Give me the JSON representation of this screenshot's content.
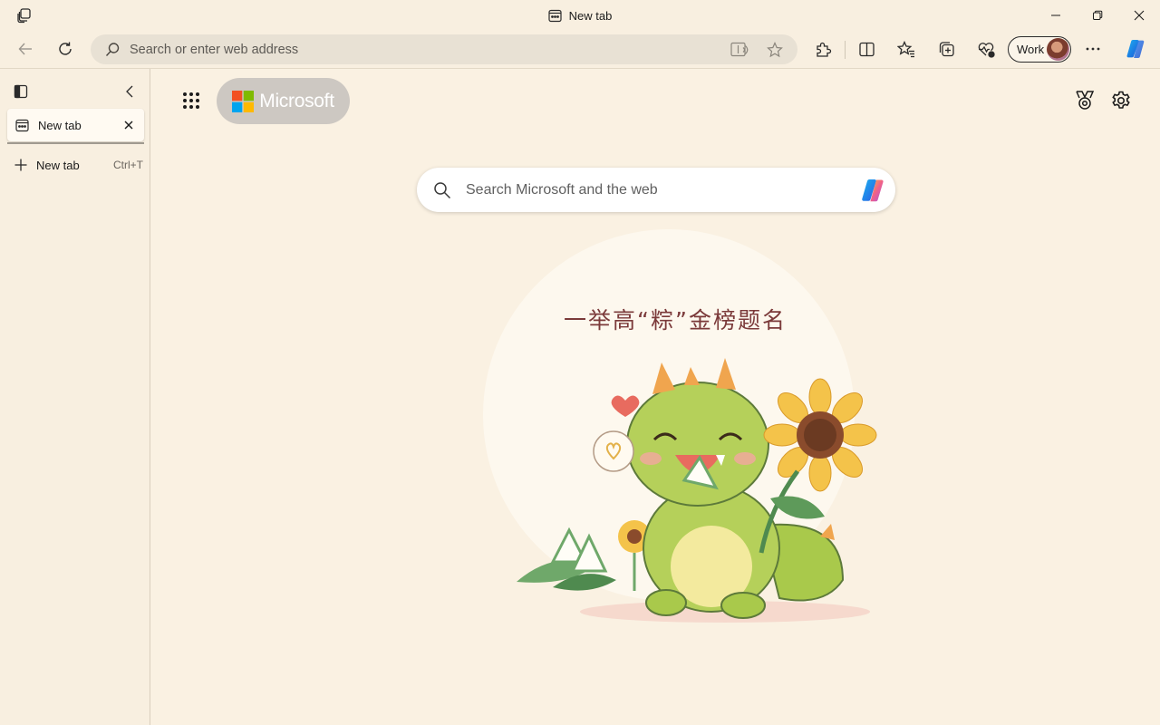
{
  "window": {
    "tab_title": "New tab",
    "controls": [
      "minimize-icon",
      "restore-icon",
      "close-icon"
    ]
  },
  "toolbar": {
    "address_placeholder": "Search or enter web address",
    "profile_label": "Work",
    "buttons": [
      "back-icon",
      "refresh-icon",
      "immersive-reader-icon",
      "favorite-star-icon",
      "extensions-icon",
      "split-screen-icon",
      "favorites-icon",
      "collections-icon",
      "browser-essentials-icon",
      "more-options-icon",
      "copilot-icon"
    ]
  },
  "sidebar": {
    "tabs": [
      {
        "label": "New tab"
      }
    ],
    "new_tab_label": "New tab",
    "new_tab_shortcut": "Ctrl+T"
  },
  "page": {
    "brand_label": "Microsoft",
    "search_placeholder": "Search Microsoft and the web",
    "hero_caption": "一举高“粽”金榜题名"
  },
  "colors": {
    "background": "#faf1e2",
    "accent_blue": "#1a73e8"
  }
}
